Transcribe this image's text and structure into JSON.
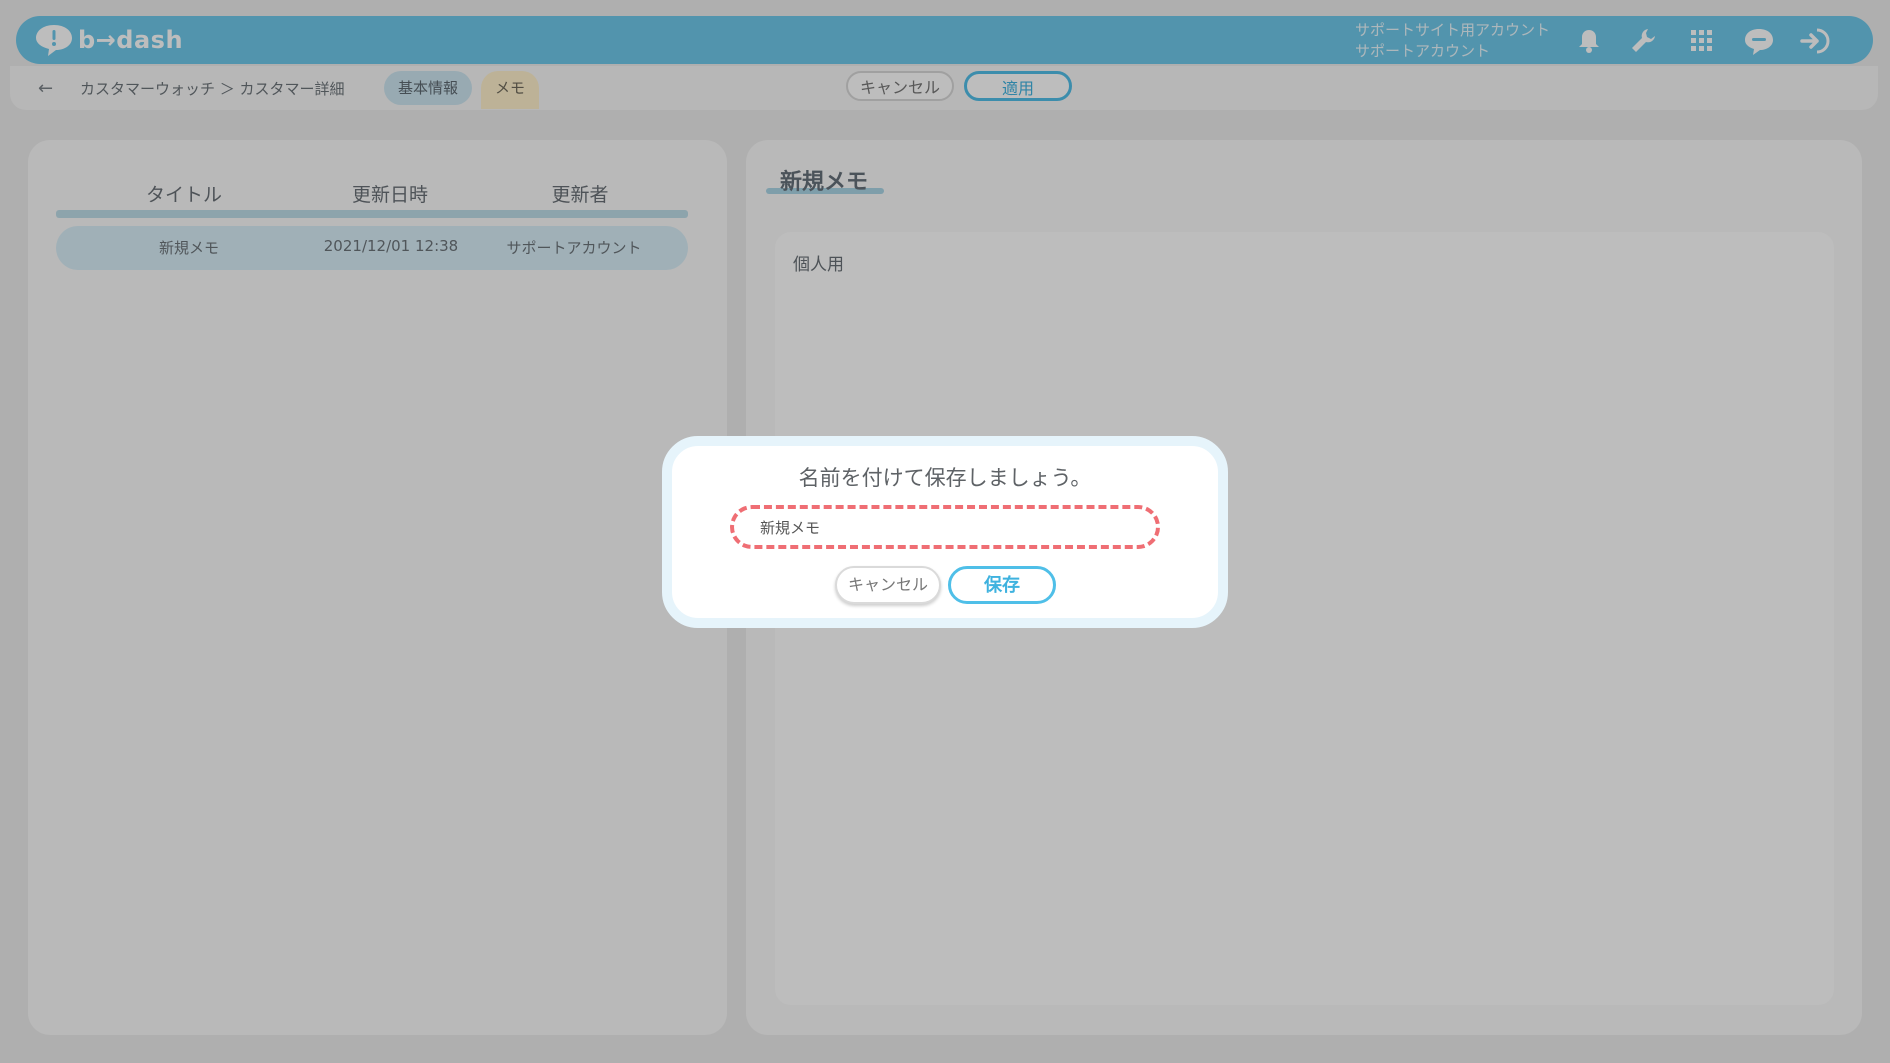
{
  "header": {
    "logo_text": "b→dash",
    "account_line1": "サポートサイト用アカウント",
    "account_line2": "サポートアカウント",
    "icons": [
      "bell-icon",
      "wrench-icon",
      "apps-grid-icon",
      "chat-bubble-icon",
      "logout-icon"
    ]
  },
  "subnav": {
    "breadcrumb": "カスタマーウォッチ ＞ カスタマー詳細",
    "tabs": [
      {
        "label": "基本情報"
      },
      {
        "label": "メモ"
      }
    ],
    "cancel_label": "キャンセル",
    "apply_label": "適用"
  },
  "memo_list": {
    "columns": [
      "タイトル",
      "更新日時",
      "更新者"
    ],
    "rows": [
      {
        "title": "新規メモ",
        "updated_at": "2021/12/01 12:38",
        "updated_by": "サポートアカウント"
      }
    ]
  },
  "memo_detail": {
    "title": "新規メモ",
    "scope": "個人用"
  },
  "dialog": {
    "message": "名前を付けて保存しましょう。",
    "name_value": "新規メモ",
    "cancel_label": "キャンセル",
    "save_label": "保存"
  },
  "colors": {
    "brand": "#6fc8ea",
    "accent": "#4fbfe8",
    "highlight_dashed": "#ef6e74"
  }
}
